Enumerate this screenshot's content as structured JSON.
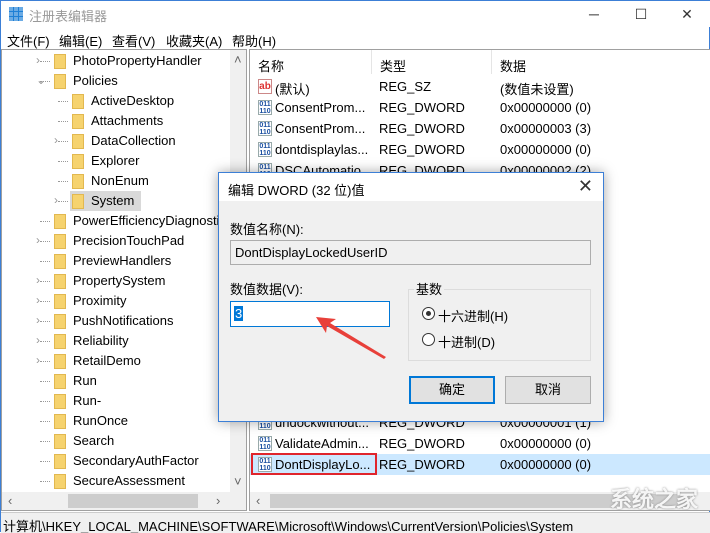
{
  "window": {
    "title": "注册表编辑器",
    "minimize": "─",
    "maximize": "☐",
    "close": "✕"
  },
  "menu": [
    "文件(F)",
    "编辑(E)",
    "查看(V)",
    "收藏夹(A)",
    "帮助(H)"
  ],
  "tree": [
    {
      "label": "PhotoPropertyHandler",
      "level": 1,
      "arrow": ">"
    },
    {
      "label": "Policies",
      "level": 1,
      "arrow": "v"
    },
    {
      "label": "ActiveDesktop",
      "level": 2,
      "arrow": ""
    },
    {
      "label": "Attachments",
      "level": 2,
      "arrow": ""
    },
    {
      "label": "DataCollection",
      "level": 2,
      "arrow": ">"
    },
    {
      "label": "Explorer",
      "level": 2,
      "arrow": ""
    },
    {
      "label": "NonEnum",
      "level": 2,
      "arrow": ""
    },
    {
      "label": "System",
      "level": 2,
      "arrow": ">",
      "selected": true
    },
    {
      "label": "PowerEfficiencyDiagnostic",
      "level": 1,
      "arrow": ""
    },
    {
      "label": "PrecisionTouchPad",
      "level": 1,
      "arrow": ">"
    },
    {
      "label": "PreviewHandlers",
      "level": 1,
      "arrow": ""
    },
    {
      "label": "PropertySystem",
      "level": 1,
      "arrow": ">"
    },
    {
      "label": "Proximity",
      "level": 1,
      "arrow": ">"
    },
    {
      "label": "PushNotifications",
      "level": 1,
      "arrow": ">"
    },
    {
      "label": "Reliability",
      "level": 1,
      "arrow": ">"
    },
    {
      "label": "RetailDemo",
      "level": 1,
      "arrow": ">"
    },
    {
      "label": "Run",
      "level": 1,
      "arrow": ""
    },
    {
      "label": "Run-",
      "level": 1,
      "arrow": ""
    },
    {
      "label": "RunOnce",
      "level": 1,
      "arrow": ""
    },
    {
      "label": "Search",
      "level": 1,
      "arrow": ""
    },
    {
      "label": "SecondaryAuthFactor",
      "level": 1,
      "arrow": ""
    },
    {
      "label": "SecureAssessment",
      "level": 1,
      "arrow": ""
    }
  ],
  "list": {
    "headers": [
      "名称",
      "类型",
      "数据"
    ],
    "rows": [
      {
        "icon": "string-value-icon",
        "name": "(默认)",
        "type": "REG_SZ",
        "data": "(数值未设置)"
      },
      {
        "icon": "dword-value-icon",
        "name": "ConsentProm...",
        "type": "REG_DWORD",
        "data": "0x00000000 (0)"
      },
      {
        "icon": "dword-value-icon",
        "name": "ConsentProm...",
        "type": "REG_DWORD",
        "data": "0x00000003 (3)"
      },
      {
        "icon": "dword-value-icon",
        "name": "dontdisplaylas...",
        "type": "REG_DWORD",
        "data": "0x00000000 (0)"
      },
      {
        "icon": "dword-value-icon",
        "name": "DSCAutomatio...",
        "type": "REG_DWORD",
        "data": "0x00000002 (2)"
      },
      {
        "icon": "dword-value-icon",
        "name": "undockwithout...",
        "type": "REG_DWORD",
        "data": "0x00000001 (1)"
      },
      {
        "icon": "dword-value-icon",
        "name": "ValidateAdmin...",
        "type": "REG_DWORD",
        "data": "0x00000000 (0)"
      },
      {
        "icon": "dword-value-icon",
        "name": "DontDisplayLo...",
        "type": "REG_DWORD",
        "data": "0x00000000 (0)",
        "selected": true,
        "highlight_color": "#e0252c"
      }
    ]
  },
  "status": "计算机\\HKEY_LOCAL_MACHINE\\SOFTWARE\\Microsoft\\Windows\\CurrentVersion\\Policies\\System",
  "dialog": {
    "title": "编辑 DWORD (32 位)值",
    "close": "✕",
    "name_label": "数值名称(N):",
    "name_value": "DontDisplayLockedUserID",
    "data_label": "数值数据(V):",
    "data_value": "3",
    "base_label": "基数",
    "hex_label": "十六进制(H)",
    "dec_label": "十进制(D)",
    "selected_base": "hex",
    "ok": "确定",
    "cancel": "取消",
    "arrow_color": "#e8403a"
  },
  "watermark": "系统之家"
}
